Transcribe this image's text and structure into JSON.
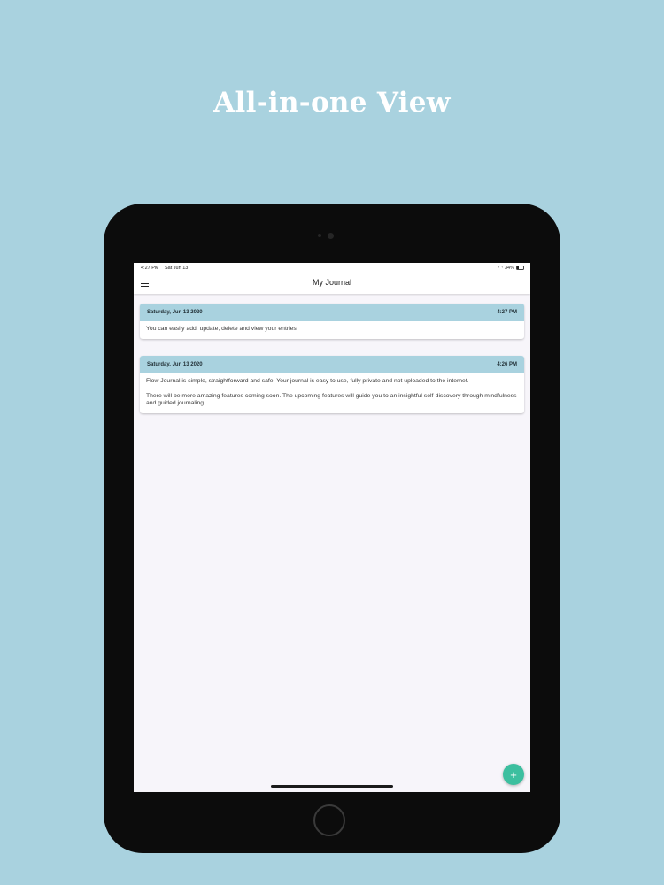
{
  "headline": "All-in-one View",
  "status_bar": {
    "time": "4:27 PM",
    "date": "Sat Jun 13",
    "battery": "34%"
  },
  "app_bar": {
    "title": "My Journal",
    "menu_icon": "hamburger-menu-icon"
  },
  "entries": [
    {
      "date": "Saturday, Jun 13 2020",
      "time": "4:27 PM",
      "paragraphs": [
        "You can easily add, update, delete and view your entries."
      ]
    },
    {
      "date": "Saturday, Jun 13 2020",
      "time": "4:26 PM",
      "paragraphs": [
        "Flow Journal is simple, straightforward and safe. Your journal is easy to use, fully private and not uploaded to the internet.",
        "There will be more amazing features coming soon. The upcoming features will guide you to an insightful self-discovery through mindfulness and guided journaling."
      ]
    }
  ],
  "fab": {
    "label": "+",
    "icon": "add-icon"
  },
  "colors": {
    "background": "#a9d2df",
    "card_header": "#a9d2df",
    "fab": "#3cbf9f",
    "screen": "#f7f5fa"
  }
}
